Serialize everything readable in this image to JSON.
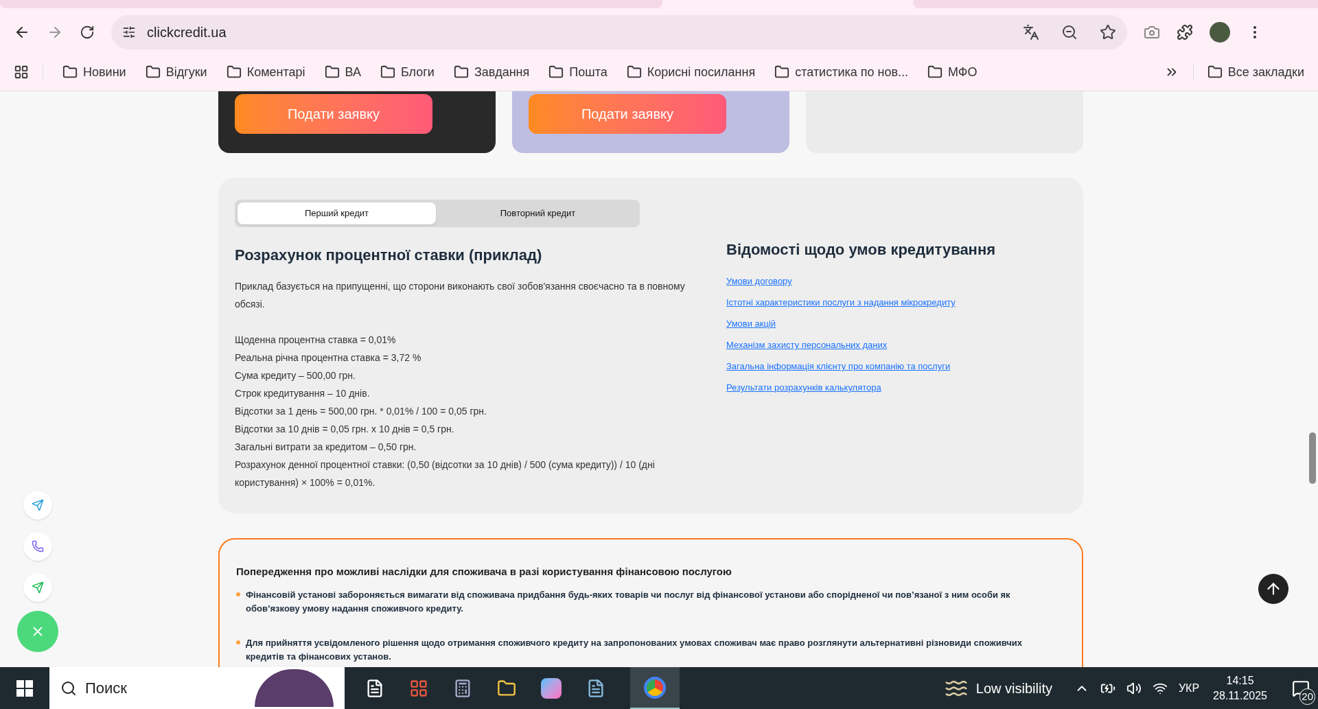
{
  "browser": {
    "url": "clickcredit.ua",
    "bookmarks": [
      "Новини",
      "Відгуки",
      "Коментарі",
      "ВА",
      "Блоги",
      "Завдання",
      "Пошта",
      "Корисні посилання",
      "статистика по нов...",
      "МФО"
    ],
    "all_bookmarks": "Все закладки"
  },
  "cards": [
    {
      "kind": "dark",
      "button": "Подати заявку"
    },
    {
      "kind": "purple",
      "button": "Подати заявку"
    },
    {
      "kind": "grey"
    }
  ],
  "calc": {
    "tabs": [
      {
        "label": "Перший кредит",
        "selected": true
      },
      {
        "label": "Повторний кредит",
        "selected": false
      }
    ],
    "title": "Розрахунок процентної ставки (приклад)",
    "intro": "Приклад базується на припущенні, що сторони виконають свої зобов'язання своєчасно та в повному обсязі.",
    "lines": [
      "Щоденна процентна ставка = 0,01%",
      "Реальна річна процентна ставка = 3,72 %",
      "Сума кредиту – 500,00 грн.",
      "Строк кредитування – 10 днів.",
      "Відсотки за 1 день = 500,00 грн. * 0,01% / 100 = 0,05 грн.",
      "Відсотки за 10 днів = 0,05 грн. x 10 днів = 0,5 грн.",
      "Загальні витрати за кредитом – 0,50 грн.",
      "Розрахунок денної процентної ставки: (0,50 (відсотки за 10 днів) / 500 (сума кредиту)) / 10 (дні користування) × 100% = 0,01%."
    ],
    "info_title": "Відомості щодо умов кредитування",
    "links": [
      "Умови договору",
      "Істотні характеристики послуги з надання мікрокредиту",
      "Умови акцій",
      "Механізм захисту персональних даних",
      "Загальна інформація клієнту про компанію та послуги",
      "Результати розрахунків калькулятора"
    ]
  },
  "warning": {
    "title": "Попередження про можливі наслідки для споживача в разі користування фінансовою послугою",
    "items": [
      "Фінансовій установі забороняється вимагати від споживача придбання будь-яких товарів чи послуг від фінансової установи або спорідненої чи пов’язаної з ним особи як обов’язкову умову надання споживчого кредиту.",
      "Для прийняття усвідомленого рішення щодо отримання споживчого кредиту на запропонованих умовах споживач має право розглянути альтернативні різновиди споживчих кредитів та фінансових установ."
    ]
  },
  "taskbar": {
    "search": "Поиск",
    "weather": "Low visibility",
    "language": "УКР",
    "time": "14:15",
    "date": "28.11.2025",
    "notifications": "20"
  }
}
